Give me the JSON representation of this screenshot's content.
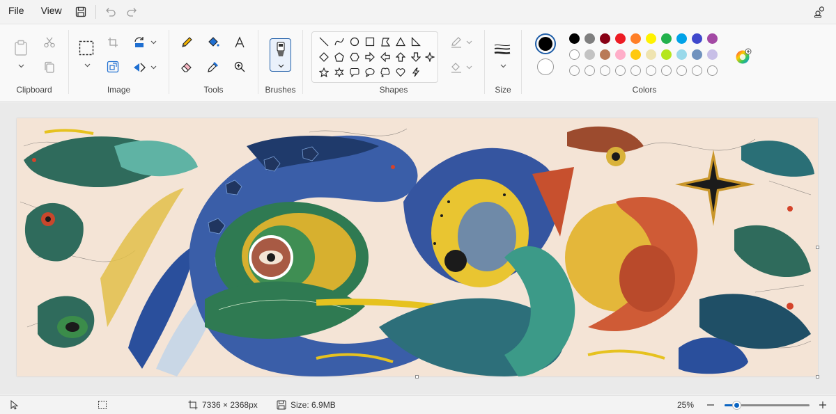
{
  "menu": {
    "file": "File",
    "view": "View"
  },
  "ribbon": {
    "clipboard_label": "Clipboard",
    "image_label": "Image",
    "tools_label": "Tools",
    "brushes_label": "Brushes",
    "shapes_label": "Shapes",
    "size_label": "Size",
    "colors_label": "Colors",
    "selected_colors": {
      "primary": "#000000",
      "secondary": "#ffffff"
    },
    "palette_row1": [
      "#000000",
      "#7f7f7f",
      "#880015",
      "#ed1c24",
      "#ff7f27",
      "#fff200",
      "#22b14c",
      "#00a2e8",
      "#3f48cc",
      "#a349a4"
    ],
    "palette_row2": [
      "#ffffff",
      "#c3c3c3",
      "#b97a57",
      "#ffaec9",
      "#ffc90e",
      "#efe4b0",
      "#b5e61d",
      "#99d9ea",
      "#7092be",
      "#c8bfe7"
    ],
    "palette_row3_count": 10
  },
  "status": {
    "dimensions": "7336 × 2368px",
    "size": "Size: 6.9MB",
    "zoom": "25%",
    "zoom_level": 0.14
  }
}
